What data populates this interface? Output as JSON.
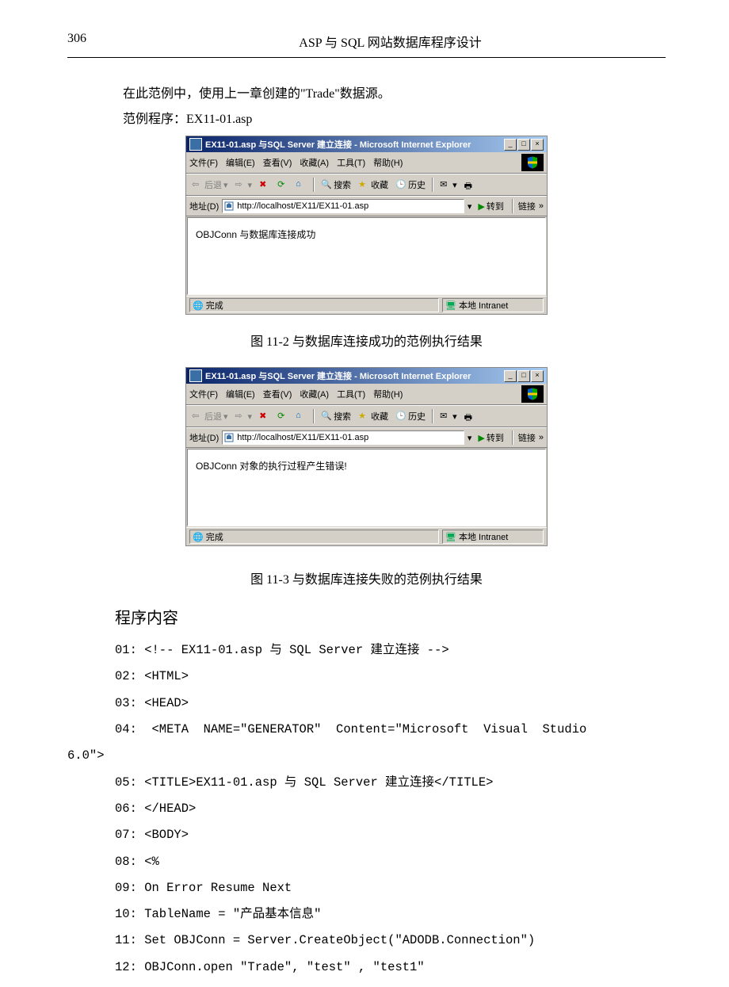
{
  "header": {
    "page_num": "306",
    "title": "ASP 与 SQL 网站数据库程序设计"
  },
  "intro": {
    "p1": "在此范例中，使用上一章创建的\"Trade\"数据源。",
    "p2": "范例程序：EX11-01.asp"
  },
  "ie_common": {
    "title": "EX11-01.asp 与SQL Server 建立连接 - Microsoft Internet Explorer",
    "menu": {
      "file": "文件(F)",
      "edit": "编辑(E)",
      "view": "查看(V)",
      "fav": "收藏(A)",
      "tools": "工具(T)",
      "help": "帮助(H)"
    },
    "toolbar": {
      "back": "后退",
      "search": "搜索",
      "favorites": "收藏",
      "history": "历史"
    },
    "addr_label": "地址(D)",
    "url": "http://localhost/EX11/EX11-01.asp",
    "go": "转到",
    "links": "链接",
    "status_done": "完成",
    "status_zone": "本地 Intranet"
  },
  "shot1": {
    "content": "OBJConn 与数据库连接成功"
  },
  "caption1": "图 11-2   与数据库连接成功的范例执行结果",
  "shot2": {
    "content": "OBJConn 对象的执行过程产生错误!"
  },
  "caption2": "图 11-3   与数据库连接失败的范例执行结果",
  "section": "程序内容",
  "code": {
    "l01": "01: <!-- EX11-01.asp 与 SQL Server 建立连接 -->",
    "l02": "02: <HTML>",
    "l03": "03: <HEAD>",
    "l04a": "04:  <META  NAME=\"GENERATOR\"  Content=\"Microsoft  Visual  Studio ",
    "l04b": "6.0\">",
    "l05": "05: <TITLE>EX11-01.asp 与 SQL Server 建立连接</TITLE>",
    "l06": "06: </HEAD>",
    "l07": "07: <BODY>",
    "l08": "08: <%",
    "l09": "09: On Error Resume Next",
    "l10": "10: TableName = \"产品基本信息\"",
    "l11": "11: Set OBJConn = Server.CreateObject(\"ADODB.Connection\")",
    "l12": "12: OBJConn.open \"Trade\", \"test\" , \"test1\""
  }
}
